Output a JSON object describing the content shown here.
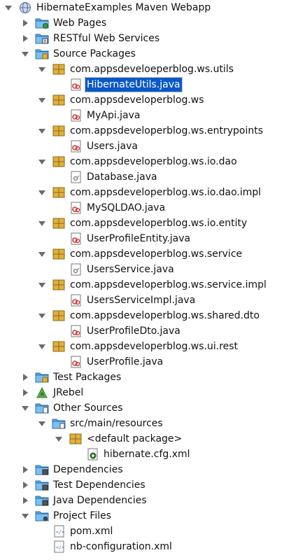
{
  "tree": [
    {
      "label": "HibernateExamples Maven Webapp",
      "level": 0,
      "expanded": true,
      "icon": "maven-project-icon"
    },
    {
      "label": "Web Pages",
      "level": 1,
      "expanded": false,
      "icon": "web-pages-folder-icon"
    },
    {
      "label": "RESTful Web Services",
      "level": 1,
      "expanded": false,
      "icon": "rest-services-folder-icon"
    },
    {
      "label": "Source Packages",
      "level": 1,
      "expanded": true,
      "icon": "source-packages-folder-icon"
    },
    {
      "label": "com.appsdeveloeperblog.ws.utils",
      "level": 2,
      "expanded": true,
      "icon": "package-icon"
    },
    {
      "label": "HibernateUtils.java",
      "level": 3,
      "icon": "java-class-icon",
      "selected": true
    },
    {
      "label": "com.appsdeveloperblog.ws",
      "level": 2,
      "expanded": true,
      "icon": "package-icon"
    },
    {
      "label": "MyApi.java",
      "level": 3,
      "icon": "java-class-icon"
    },
    {
      "label": "com.appsdeveloperblog.ws.entrypoints",
      "level": 2,
      "expanded": true,
      "icon": "package-icon"
    },
    {
      "label": "Users.java",
      "level": 3,
      "icon": "java-class-icon"
    },
    {
      "label": "com.appsdeveloperblog.ws.io.dao",
      "level": 2,
      "expanded": true,
      "icon": "package-icon"
    },
    {
      "label": "Database.java",
      "level": 3,
      "icon": "java-interface-icon"
    },
    {
      "label": "com.appsdeveloperblog.ws.io.dao.impl",
      "level": 2,
      "expanded": true,
      "icon": "package-icon"
    },
    {
      "label": "MySQLDAO.java",
      "level": 3,
      "icon": "java-class-icon"
    },
    {
      "label": "com.appsdeveloperblog.ws.io.entity",
      "level": 2,
      "expanded": true,
      "icon": "package-icon"
    },
    {
      "label": "UserProfileEntity.java",
      "level": 3,
      "icon": "java-class-icon"
    },
    {
      "label": "com.appsdeveloperblog.ws.service",
      "level": 2,
      "expanded": true,
      "icon": "package-icon"
    },
    {
      "label": "UsersService.java",
      "level": 3,
      "icon": "java-interface-icon"
    },
    {
      "label": "com.appsdeveloperblog.ws.service.impl",
      "level": 2,
      "expanded": true,
      "icon": "package-icon"
    },
    {
      "label": "UsersServiceImpl.java",
      "level": 3,
      "icon": "java-class-icon"
    },
    {
      "label": "com.appsdeveloperblog.ws.shared.dto",
      "level": 2,
      "expanded": true,
      "icon": "package-icon"
    },
    {
      "label": "UserProfileDto.java",
      "level": 3,
      "icon": "java-class-icon"
    },
    {
      "label": "com.appsdeveloperblog.ws.ui.rest",
      "level": 2,
      "expanded": true,
      "icon": "package-icon"
    },
    {
      "label": "UserProfile.java",
      "level": 3,
      "icon": "java-class-icon"
    },
    {
      "label": "Test Packages",
      "level": 1,
      "expanded": false,
      "icon": "test-packages-folder-icon"
    },
    {
      "label": "JRebel",
      "level": 1,
      "expanded": false,
      "icon": "jrebel-icon"
    },
    {
      "label": "Other Sources",
      "level": 1,
      "expanded": true,
      "icon": "other-sources-folder-icon"
    },
    {
      "label": "src/main/resources",
      "level": 2,
      "expanded": true,
      "icon": "resources-folder-icon"
    },
    {
      "label": "<default package>",
      "level": 3,
      "expanded": true,
      "icon": "package-icon"
    },
    {
      "label": "hibernate.cfg.xml",
      "level": 4,
      "icon": "xml-config-file-icon"
    },
    {
      "label": "Dependencies",
      "level": 1,
      "expanded": false,
      "icon": "dependencies-folder-icon"
    },
    {
      "label": "Test Dependencies",
      "level": 1,
      "expanded": false,
      "icon": "dependencies-folder-icon"
    },
    {
      "label": "Java Dependencies",
      "level": 1,
      "expanded": false,
      "icon": "dependencies-folder-icon"
    },
    {
      "label": "Project Files",
      "level": 1,
      "expanded": true,
      "icon": "project-files-folder-icon"
    },
    {
      "label": "pom.xml",
      "level": 2,
      "icon": "xml-file-icon"
    },
    {
      "label": "nb-configuration.xml",
      "level": 2,
      "icon": "xml-file-icon"
    }
  ],
  "colors": {
    "selection": "#0a58c8",
    "folder": "#5aa8e6",
    "package": "#e0b040",
    "toggle": "#6b6b6b"
  }
}
